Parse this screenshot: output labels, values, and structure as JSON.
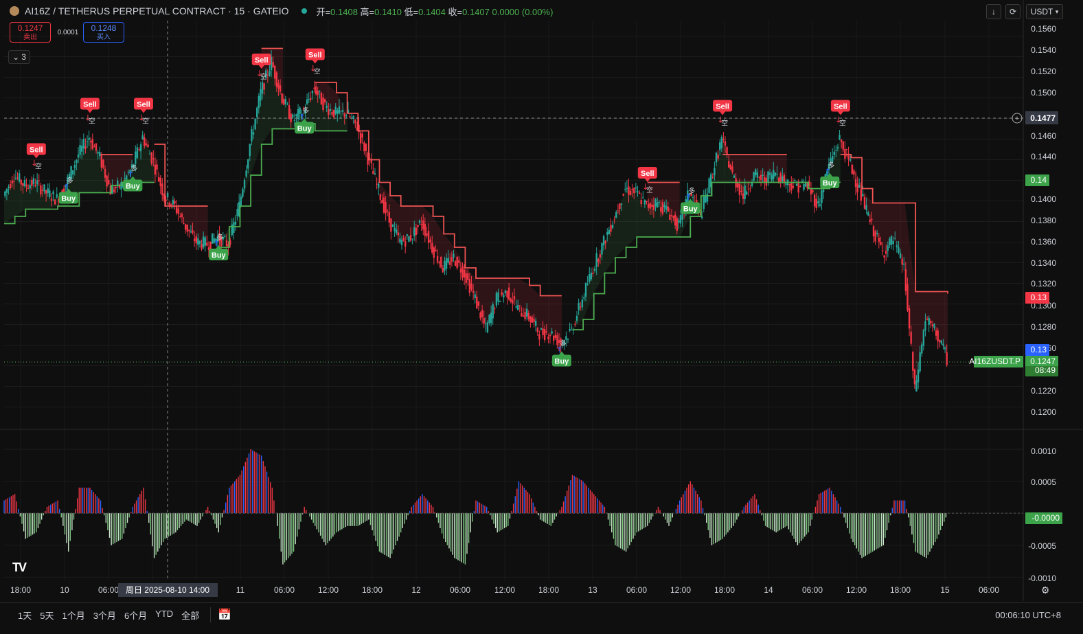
{
  "header": {
    "title": "AI16Z / TETHERUS PERPETUAL CONTRACT · 15 · GATEIO",
    "ohlc": [
      {
        "label": "开=",
        "value": "0.1408"
      },
      {
        "label": "高=",
        "value": "0.1410"
      },
      {
        "label": "低=",
        "value": "0.1404"
      },
      {
        "label": "收=",
        "value": "0.1407"
      }
    ],
    "change": "0.0000 (0.00%)"
  },
  "trade": {
    "sell_price": "0.1247",
    "sell_label": "卖出",
    "spread": "0.0001",
    "buy_price": "0.1248",
    "buy_label": "买入"
  },
  "indicators_toggle": "3",
  "currency": "USDT",
  "price_axis": [
    "0.1560",
    "0.1540",
    "0.1520",
    "0.1500",
    "0.1460",
    "0.1440",
    "0.1400",
    "0.1380",
    "0.1360",
    "0.1340",
    "0.1320",
    "0.1300",
    "0.1280",
    "0.1260",
    "0.1220",
    "0.1200"
  ],
  "osc_axis": [
    "0.0010",
    "0.0005",
    "-0.0005",
    "-0.0010"
  ],
  "time_axis": [
    "18:00",
    "10",
    "06:00",
    "11",
    "06:00",
    "12:00",
    "18:00",
    "12",
    "06:00",
    "12:00",
    "18:00",
    "13",
    "06:00",
    "12:00",
    "18:00",
    "14",
    "06:00",
    "12:00",
    "18:00",
    "15",
    "06:00"
  ],
  "crosshair": {
    "time_label": "周日 2025-08-10  14:00",
    "price_label": "0.1477"
  },
  "price_tags": {
    "green_level": "0.14",
    "red_level": "0.13",
    "blue_level": "0.13",
    "symbol": "AI16ZUSDT.P",
    "last": "0.1247",
    "countdown": "08:49",
    "osc_last": "-0.0000"
  },
  "signal_labels": {
    "sell": "Sell",
    "buy": "Buy",
    "short": "空",
    "long": "多"
  },
  "colors": {
    "up": "#26a69a",
    "down": "#f23645",
    "green_line": "#4caf50",
    "red_line": "#f05454",
    "blue": "#2962ff"
  },
  "chart_data": {
    "type": "line",
    "price_close": [
      0.1405,
      0.1425,
      0.1415,
      0.1418,
      0.1408,
      0.1402,
      0.142,
      0.1445,
      0.1462,
      0.1442,
      0.141,
      0.1415,
      0.1432,
      0.1462,
      0.1438,
      0.1405,
      0.1395,
      0.1375,
      0.136,
      0.1358,
      0.1365,
      0.1358,
      0.1395,
      0.1455,
      0.1505,
      0.1535,
      0.15,
      0.1478,
      0.1488,
      0.151,
      0.1492,
      0.1485,
      0.1485,
      0.1472,
      0.1442,
      0.141,
      0.138,
      0.136,
      0.1365,
      0.138,
      0.1355,
      0.1335,
      0.1345,
      0.133,
      0.1305,
      0.1275,
      0.1305,
      0.1312,
      0.1295,
      0.1288,
      0.1272,
      0.1272,
      0.1262,
      0.1275,
      0.1305,
      0.1335,
      0.136,
      0.1385,
      0.1412,
      0.1408,
      0.1395,
      0.1398,
      0.139,
      0.1375,
      0.141,
      0.1385,
      0.1422,
      0.146,
      0.1425,
      0.1405,
      0.1425,
      0.142,
      0.1428,
      0.1418,
      0.1415,
      0.1415,
      0.1395,
      0.1435,
      0.146,
      0.1435,
      0.1405,
      0.1375,
      0.135,
      0.1362,
      0.1335,
      0.1215,
      0.1285,
      0.1272,
      0.1247
    ],
    "supertrend_green": [
      0.1378,
      0.1385,
      0.1392,
      0.1392,
      0.1392,
      0.1395,
      0.1395,
      0.1408,
      0.1408,
      0.1408,
      0.1415,
      0.1418,
      0.1418,
      0.1418,
      0.1418,
      null,
      null,
      null,
      null,
      null,
      0.1355,
      0.1375,
      0.1395,
      0.1425,
      0.1455,
      0.147,
      0.147,
      0.147,
      0.1475,
      0.1468,
      0.1468,
      0.1468,
      0.1468,
      null,
      null,
      null,
      null,
      null,
      null,
      null,
      null,
      null,
      null,
      null,
      null,
      null,
      null,
      null,
      null,
      null,
      null,
      null,
      null,
      0.1275,
      0.1285,
      0.131,
      0.133,
      0.1345,
      0.1355,
      0.1365,
      0.1365,
      0.1365,
      0.1365,
      0.1365,
      0.1385,
      0.1405,
      0.1418,
      0.1418,
      0.1418,
      0.1418,
      0.1418,
      0.1418,
      0.1418,
      0.1418,
      0.1418,
      0.1412,
      0.1412,
      0.1418,
      0.1418,
      null,
      null,
      null,
      null,
      null,
      null,
      null,
      null,
      null,
      null
    ],
    "supertrend_red": [
      null,
      null,
      null,
      null,
      null,
      null,
      null,
      null,
      null,
      0.1445,
      0.1445,
      0.1445,
      0.1445,
      null,
      0.1455,
      0.1395,
      0.1395,
      0.1395,
      0.1395,
      0.1395,
      null,
      null,
      null,
      null,
      0.1548,
      0.1548,
      0.1548,
      null,
      null,
      0.1515,
      0.1515,
      0.1505,
      0.1485,
      0.1468,
      0.144,
      0.1418,
      0.1405,
      0.1395,
      0.1395,
      0.1395,
      0.1385,
      0.1368,
      0.1355,
      0.1335,
      0.1325,
      0.1325,
      0.1325,
      0.1325,
      0.1325,
      0.1318,
      0.1308,
      0.1308,
      0.1308,
      null,
      null,
      null,
      null,
      null,
      null,
      null,
      0.1418,
      0.1418,
      0.1418,
      0.1418,
      null,
      null,
      null,
      0.1445,
      0.1445,
      0.1445,
      0.1445,
      0.1445,
      0.1445,
      0.1445,
      null,
      null,
      null,
      null,
      0.1445,
      0.1442,
      0.1412,
      0.1398,
      0.1398,
      0.1398,
      0.1398,
      0.1312,
      0.1312,
      0.1312,
      0.131
    ],
    "signals": [
      {
        "type": "Sell",
        "index": 3
      },
      {
        "type": "Buy",
        "index": 6
      },
      {
        "type": "Sell",
        "index": 8
      },
      {
        "type": "Buy",
        "index": 12
      },
      {
        "type": "Sell",
        "index": 13
      },
      {
        "type": "Buy",
        "index": 20
      },
      {
        "type": "Sell",
        "index": 24
      },
      {
        "type": "Buy",
        "index": 28
      },
      {
        "type": "Sell",
        "index": 29
      },
      {
        "type": "Buy",
        "index": 52
      },
      {
        "type": "Sell",
        "index": 60
      },
      {
        "type": "Buy",
        "index": 64
      },
      {
        "type": "Sell",
        "index": 67
      },
      {
        "type": "Buy",
        "index": 77
      },
      {
        "type": "Sell",
        "index": 78
      }
    ],
    "oscillator": [
      0.0002,
      0.0003,
      -0.0004,
      -0.0003,
      0.0001,
      0.0002,
      -0.0006,
      0.0004,
      0.0004,
      0.0002,
      -0.0005,
      -0.0004,
      0.0001,
      0.0004,
      -0.0007,
      -0.0004,
      -0.0003,
      -0.0001,
      -0.0002,
      0.0001,
      -0.0003,
      0.0004,
      0.0006,
      0.001,
      0.0009,
      0.0004,
      -0.0008,
      -0.0006,
      0.0001,
      -0.0002,
      -0.0005,
      -0.0003,
      -0.0002,
      -0.0002,
      -0.0001,
      -0.0006,
      -0.0007,
      -0.0003,
      0.0001,
      0.0003,
      0.0001,
      -0.0004,
      -0.0007,
      -0.0008,
      0.0002,
      0.0001,
      -0.0003,
      -0.0002,
      0.0005,
      0.0003,
      -0.0001,
      -0.0002,
      0.0001,
      0.0006,
      0.0005,
      0.0003,
      0.0001,
      -0.0005,
      -0.0006,
      -0.0003,
      -0.0002,
      0.0001,
      -0.0002,
      0.0002,
      0.0005,
      0.0002,
      -0.0005,
      -0.0004,
      -0.0002,
      0.0001,
      0.0003,
      -0.0002,
      -0.0003,
      -0.0002,
      -0.0005,
      -0.0003,
      0.0003,
      0.0004,
      0.0001,
      -0.0004,
      -0.0007,
      -0.0006,
      -0.0005,
      0.0002,
      0.0002,
      -0.0006,
      -0.0007,
      -0.0004,
      0.0
    ],
    "price_range": [
      0.1185,
      0.1575
    ],
    "osc_range": [
      -0.00105,
      0.00115
    ]
  }
}
